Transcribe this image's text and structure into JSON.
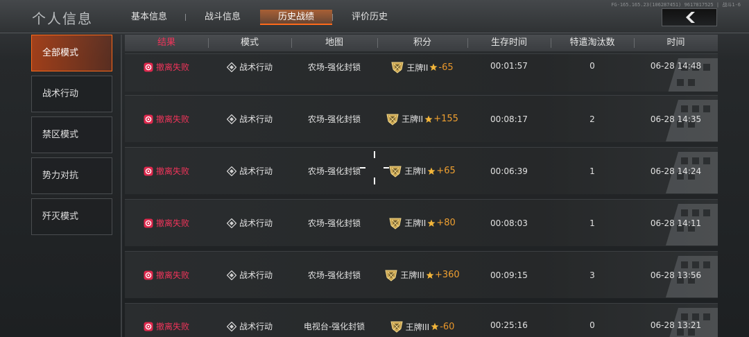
{
  "header": {
    "title": "个人信息",
    "tabs": [
      {
        "label": "基本信息",
        "active": false
      },
      {
        "label": "战斗信息",
        "active": false
      },
      {
        "label": "历史战绩",
        "active": true
      },
      {
        "label": "评价历史",
        "active": false
      }
    ],
    "server_info": "FG-165.165.23(106287451) 9617817525 | 战斗1-6",
    "back_icon": "chevron-left-icon"
  },
  "sidebar": {
    "items": [
      {
        "label": "全部模式",
        "active": true
      },
      {
        "label": "战术行动",
        "active": false
      },
      {
        "label": "禁区模式",
        "active": false
      },
      {
        "label": "势力对抗",
        "active": false
      },
      {
        "label": "歼灭模式",
        "active": false
      }
    ]
  },
  "table": {
    "columns": [
      "结果",
      "模式",
      "地图",
      "积分",
      "生存时间",
      "特遣淘汰数",
      "时间"
    ],
    "rows": [
      {
        "result": "撤离失败",
        "mode": "战术行动",
        "map": "农场-强化封锁",
        "rank": "王牌II",
        "delta": "-65",
        "survival": "00:01:57",
        "kills": "0",
        "date": "06-28 14:48"
      },
      {
        "result": "撤离失败",
        "mode": "战术行动",
        "map": "农场-强化封锁",
        "rank": "王牌II",
        "delta": "+155",
        "survival": "00:08:17",
        "kills": "2",
        "date": "06-28 14:35"
      },
      {
        "result": "撤离失败",
        "mode": "战术行动",
        "map": "农场-强化封锁",
        "rank": "王牌II",
        "delta": "+65",
        "survival": "00:06:39",
        "kills": "1",
        "date": "06-28 14:24"
      },
      {
        "result": "撤离失败",
        "mode": "战术行动",
        "map": "农场-强化封锁",
        "rank": "王牌II",
        "delta": "+80",
        "survival": "00:08:03",
        "kills": "1",
        "date": "06-28 14:11"
      },
      {
        "result": "撤离失败",
        "mode": "战术行动",
        "map": "农场-强化封锁",
        "rank": "王牌III",
        "delta": "+360",
        "survival": "00:09:15",
        "kills": "3",
        "date": "06-28 13:56"
      },
      {
        "result": "撤离失败",
        "mode": "战术行动",
        "map": "电视台-强化封锁",
        "rank": "王牌III",
        "delta": "-60",
        "survival": "00:25:16",
        "kills": "0",
        "date": "06-28 13:21"
      }
    ]
  },
  "colors": {
    "accent": "#ff6a1a",
    "fail": "#f0345a",
    "score_delta": "#f0a030",
    "background": "#1d2022"
  }
}
